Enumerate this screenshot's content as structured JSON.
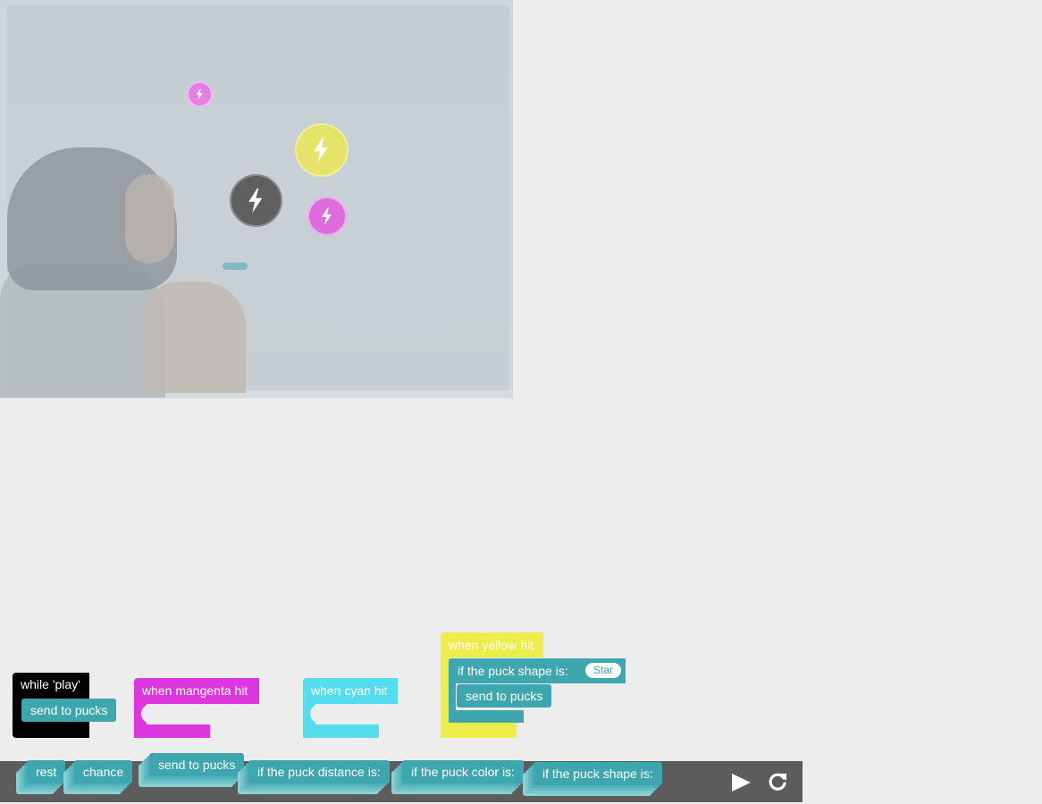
{
  "workspace": {
    "while_block": {
      "label": "while 'play'",
      "inner": "send to pucks"
    },
    "magenta_block": {
      "label": "when mangenta hit"
    },
    "cyan_block": {
      "label": "when cyan hit"
    },
    "yellow_block": {
      "label": "when yellow hit",
      "if_label": "if the puck shape is:",
      "if_value": "Star",
      "inner": "send to pucks"
    }
  },
  "toolbox": {
    "items": [
      {
        "label": "rest"
      },
      {
        "label": "chance"
      },
      {
        "label": "send to pucks"
      },
      {
        "label": "if the puck distance is:"
      },
      {
        "label": "if the puck color is:"
      },
      {
        "label": "if the puck shape is:"
      }
    ]
  },
  "controls": {
    "play_icon": "play-icon",
    "refresh_icon": "refresh-icon"
  },
  "colors": {
    "teal": "#3ea6ae",
    "magenta": "#de36de",
    "cyan": "#54dcef",
    "yellow": "#eded4a",
    "black": "#000000",
    "toolbar": "#5c5c5c"
  },
  "pucks": [
    {
      "color": "magenta",
      "icon": "lightning-icon"
    },
    {
      "color": "yellow",
      "icon": "lightning-icon"
    },
    {
      "color": "gray",
      "icon": "lightning-icon"
    },
    {
      "color": "magenta",
      "icon": "lightning-icon"
    }
  ]
}
